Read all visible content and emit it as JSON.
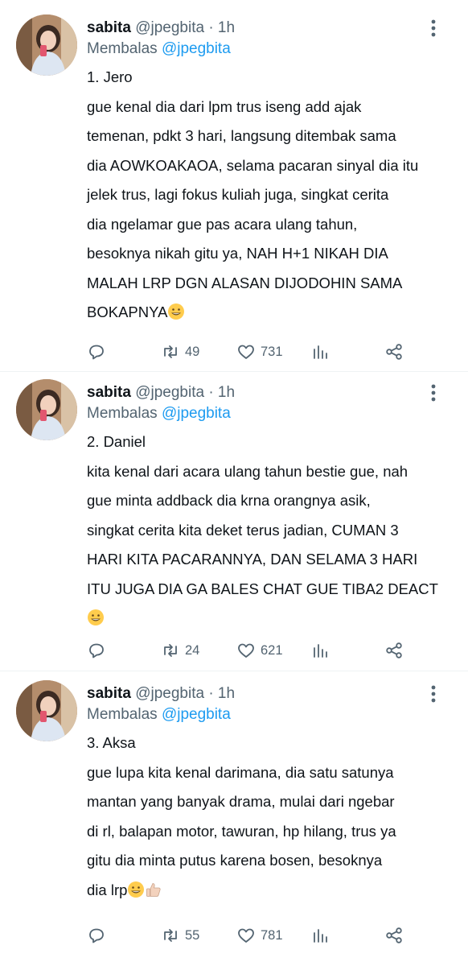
{
  "tweets": [
    {
      "author_name": "sabita",
      "author_meta": "@jpegbita · 1h",
      "reply_prefix": "Membalas",
      "reply_handle": "@jpegbita",
      "lines": [
        "1. Jero",
        "gue kenal dia dari lpm trus iseng add ajak",
        "temenan, pdkt 3 hari, langsung ditembak sama",
        "dia AOWKOAKAOA, selama pacaran sinyal dia itu",
        "jelek trus, lagi fokus kuliah juga, singkat cerita",
        "dia ngelamar gue pas acara ulang tahun,",
        "besoknya nikah gitu ya, NAH H+1 NIKAH DIA",
        "MALAH LRP DGN ALASAN DIJODOHIN SAMA",
        "BOKAPNYA"
      ],
      "retweets": "49",
      "likes": "731"
    },
    {
      "author_name": "sabita",
      "author_meta": "@jpegbita · 1h",
      "reply_prefix": "Membalas",
      "reply_handle": "@jpegbita",
      "lines": [
        "2. Daniel",
        "kita kenal dari acara ulang tahun bestie gue, nah",
        "gue minta addback dia krna orangnya asik,",
        "singkat cerita kita deket terus jadian, CUMAN 3",
        "HARI KITA PACARANNYA, DAN SELAMA 3 HARI",
        "ITU JUGA DIA GA BALES CHAT GUE TIBA2 DEACT",
        ""
      ],
      "retweets": "24",
      "likes": "621"
    },
    {
      "author_name": "sabita",
      "author_meta": "@jpegbita · 1h",
      "reply_prefix": "Membalas",
      "reply_handle": "@jpegbita",
      "lines": [
        "3. Aksa",
        "gue lupa kita kenal darimana, dia satu satunya",
        "mantan yang banyak drama, mulai dari ngebar",
        "di rl, balapan motor, tawuran, hp hilang, trus ya",
        "gitu dia minta putus karena bosen, besoknya",
        "dia lrp"
      ],
      "retweets": "55",
      "likes": "781"
    }
  ],
  "icons": {
    "reply": "reply-icon",
    "retweet": "retweet-icon",
    "like": "heart-icon",
    "views": "analytics-icon",
    "share": "share-icon",
    "more": "more-vertical-icon",
    "emoji_grin": "grinning-emoji",
    "emoji_thumb": "thumbs-up-emoji"
  },
  "colors": {
    "text": "#0f1419",
    "secondary": "#536471",
    "link": "#1d9bf0",
    "divider": "#eff3f4"
  }
}
